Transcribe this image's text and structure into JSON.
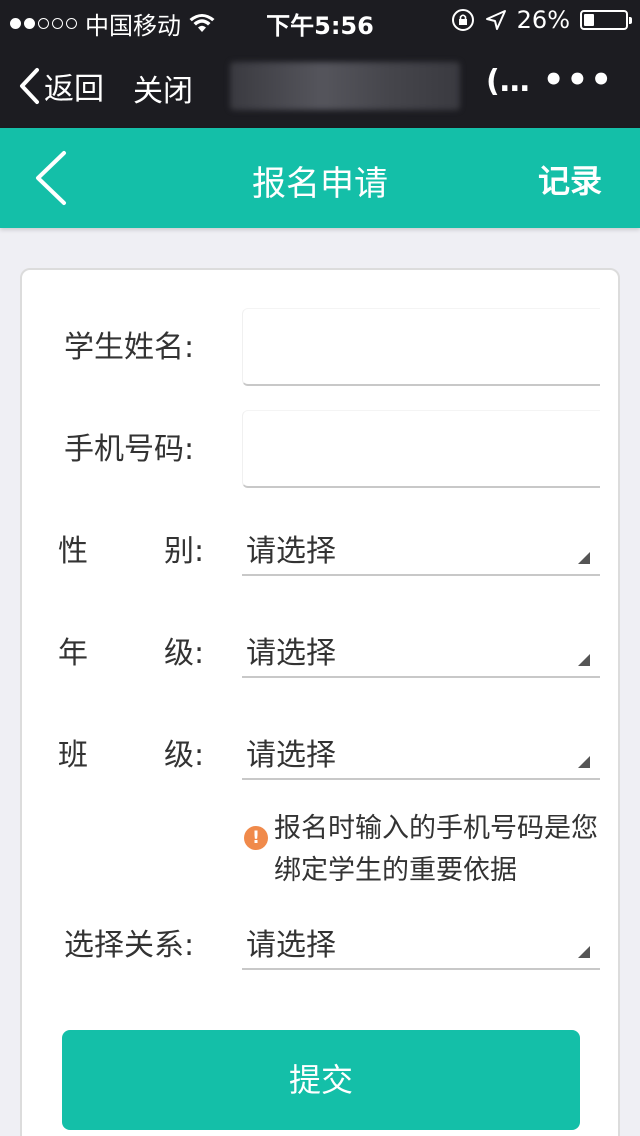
{
  "status_bar": {
    "carrier": "中国移动",
    "time": "下午5:56",
    "battery": "26%",
    "battery_level": 0.26,
    "signal_dots_filled": 2,
    "signal_dots_total": 5
  },
  "wechat_nav": {
    "back_label": "返回",
    "close_label": "关闭",
    "title_suffix": "(…",
    "more_label": "•••"
  },
  "header": {
    "title": "报名申请",
    "record_label": "记录"
  },
  "form": {
    "student_name_label": "学生姓名:",
    "phone_label": "手机号码:",
    "gender_label_a": "性",
    "gender_label_b": "别:",
    "gender_value": "请选择",
    "grade_label_a": "年",
    "grade_label_b": "级:",
    "grade_value": "请选择",
    "class_label_a": "班",
    "class_label_b": "级:",
    "class_value": "请选择",
    "notice_icon": "!",
    "notice_text": "报名时输入的手机号码是您绑定学生的重要依据",
    "relation_label": "选择关系:",
    "relation_value": "请选择",
    "submit_label": "提交"
  },
  "colors": {
    "accent": "#14bfa8",
    "status_bg": "#1c1c21",
    "notice": "#f08a4b"
  }
}
